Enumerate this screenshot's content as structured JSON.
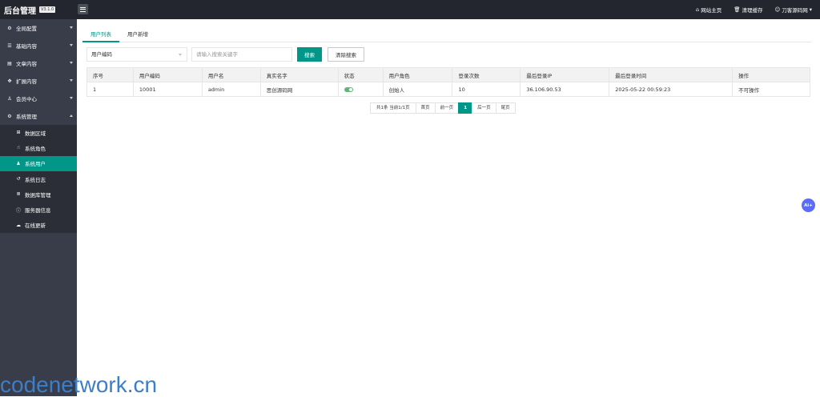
{
  "header": {
    "brand_title": "后台管理",
    "version": "V3.1.0",
    "links": [
      {
        "icon": "home-icon",
        "label": "网站主页"
      },
      {
        "icon": "trash-icon",
        "label": "清理缓存"
      },
      {
        "icon": "user-icon",
        "label": "刀客源码网"
      }
    ]
  },
  "sidebar": {
    "items": [
      {
        "icon": "gear-icon",
        "label": "全局配置"
      },
      {
        "icon": "sliders-icon",
        "label": "基础内容"
      },
      {
        "icon": "file-icon",
        "label": "文章内容"
      },
      {
        "icon": "puzzle-icon",
        "label": "扩展内容"
      },
      {
        "icon": "user-icon",
        "label": "会员中心"
      },
      {
        "icon": "gear-icon",
        "label": "系统管理"
      }
    ],
    "subitems": [
      {
        "icon": "sitemap-icon",
        "label": "数据区域"
      },
      {
        "icon": "hand-icon",
        "label": "系统角色"
      },
      {
        "icon": "users-icon",
        "label": "系统用户"
      },
      {
        "icon": "history-icon",
        "label": "系统日志"
      },
      {
        "icon": "database-icon",
        "label": "数据库管理"
      },
      {
        "icon": "info-icon",
        "label": "服务器信息"
      },
      {
        "icon": "cloud-icon",
        "label": "在线更新"
      }
    ]
  },
  "tabs": [
    {
      "label": "用户列表"
    },
    {
      "label": "用户新增"
    }
  ],
  "toolbar": {
    "select_value": "用户编码",
    "search_placeholder": "请输入搜索关键字",
    "search_label": "搜索",
    "clear_label": "清除搜索"
  },
  "table": {
    "headers": [
      "序号",
      "用户编码",
      "用户名",
      "真实名字",
      "状态",
      "用户角色",
      "登录次数",
      "最后登录IP",
      "最后登录时间",
      "操作"
    ],
    "rows": [
      {
        "no": "1",
        "code": "10001",
        "username": "admin",
        "realname": "思创源码网",
        "status": "on",
        "role": "创始人",
        "logins": "10",
        "ip": "36.106.90.53",
        "time": "2025-05-22 00:59:23",
        "action": "不可操作"
      }
    ]
  },
  "pager": {
    "info": "共1条 当前1/1页",
    "first": "首页",
    "prev": "前一页",
    "current": "1",
    "next": "后一页",
    "last": "尾页"
  },
  "ai_button": "Ai+",
  "watermark": "codenetwork.cn",
  "colors": {
    "accent": "#009688",
    "topbar": "#23262e",
    "sidebar": "#393d49",
    "switch_on": "#5fb878",
    "ai": "#5b6cf7"
  }
}
